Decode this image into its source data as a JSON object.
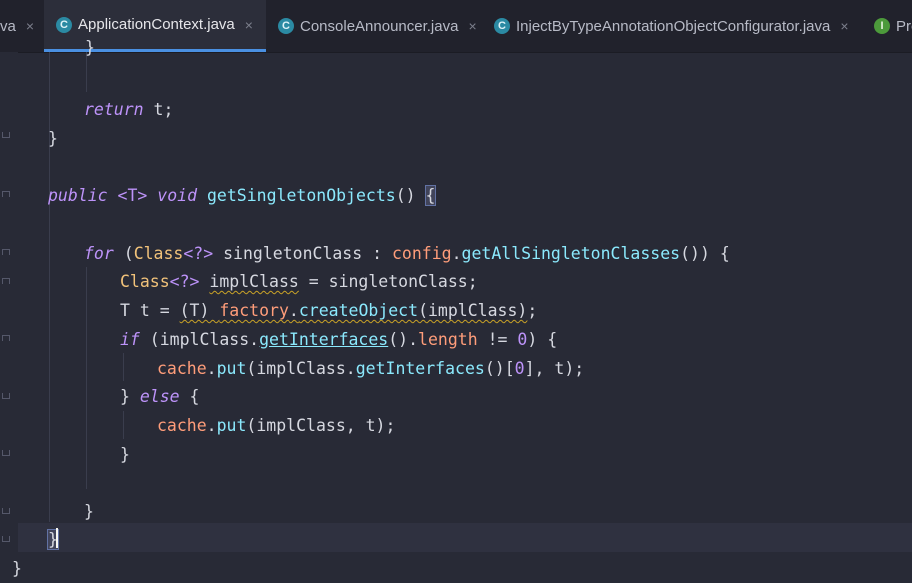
{
  "tabs": [
    {
      "label": "va",
      "icon": "none",
      "close": "×"
    },
    {
      "label": "ApplicationContext.java",
      "icon": "class-icon",
      "close": "×"
    },
    {
      "label": "ConsoleAnnouncer.java",
      "icon": "class-icon",
      "close": "×"
    },
    {
      "label": "InjectByTypeAnnotationObjectConfigurator.java",
      "icon": "class-icon",
      "close": "×"
    },
    {
      "label": "Pro",
      "icon": "interface-icon"
    }
  ],
  "tab_icon_letters": {
    "class": "C",
    "interface": "I"
  },
  "code": {
    "l01": "}",
    "l03a": "return",
    "l03b": " t;",
    "l04": "}",
    "l06a": "public",
    "l06b": "<T>",
    "l06c": "void",
    "l06d": "getSingletonObjects",
    "l06e": "() ",
    "l06f": "{",
    "l08a": "for",
    "l08b": " (",
    "l08c": "Class",
    "l08d": "<?>",
    "l08e": " singletonClass : ",
    "l08f": "config",
    "l08g": ".",
    "l08h": "getAllSingletonClasses",
    "l08i": "()) {",
    "l09a": "Class",
    "l09b": "<?>",
    "l09c": "implClass",
    "l09d": " = singletonClass;",
    "l10a": "T t = ",
    "l10b": "(T) ",
    "l10c": "factory",
    "l10d": ".",
    "l10e": "createObject",
    "l10f": "(implClass)",
    "l10g": ";",
    "l11a": "if",
    "l11b": " (implClass.",
    "l11c": "getInterfaces",
    "l11d": "().",
    "l11e": "length",
    "l11f": " != ",
    "l11g": "0",
    "l11h": ") {",
    "l12a": "cache",
    "l12b": ".",
    "l12c": "put",
    "l12d": "(implClass.",
    "l12e": "getInterfaces",
    "l12f": "()[",
    "l12g": "0",
    "l12h": "], t);",
    "l13a": "} ",
    "l13b": "else",
    "l13c": " {",
    "l14a": "cache",
    "l14b": ".",
    "l14c": "put",
    "l14d": "(implClass, t);",
    "l15": "}",
    "l17": "}",
    "l18": "}",
    "l19": "}"
  }
}
